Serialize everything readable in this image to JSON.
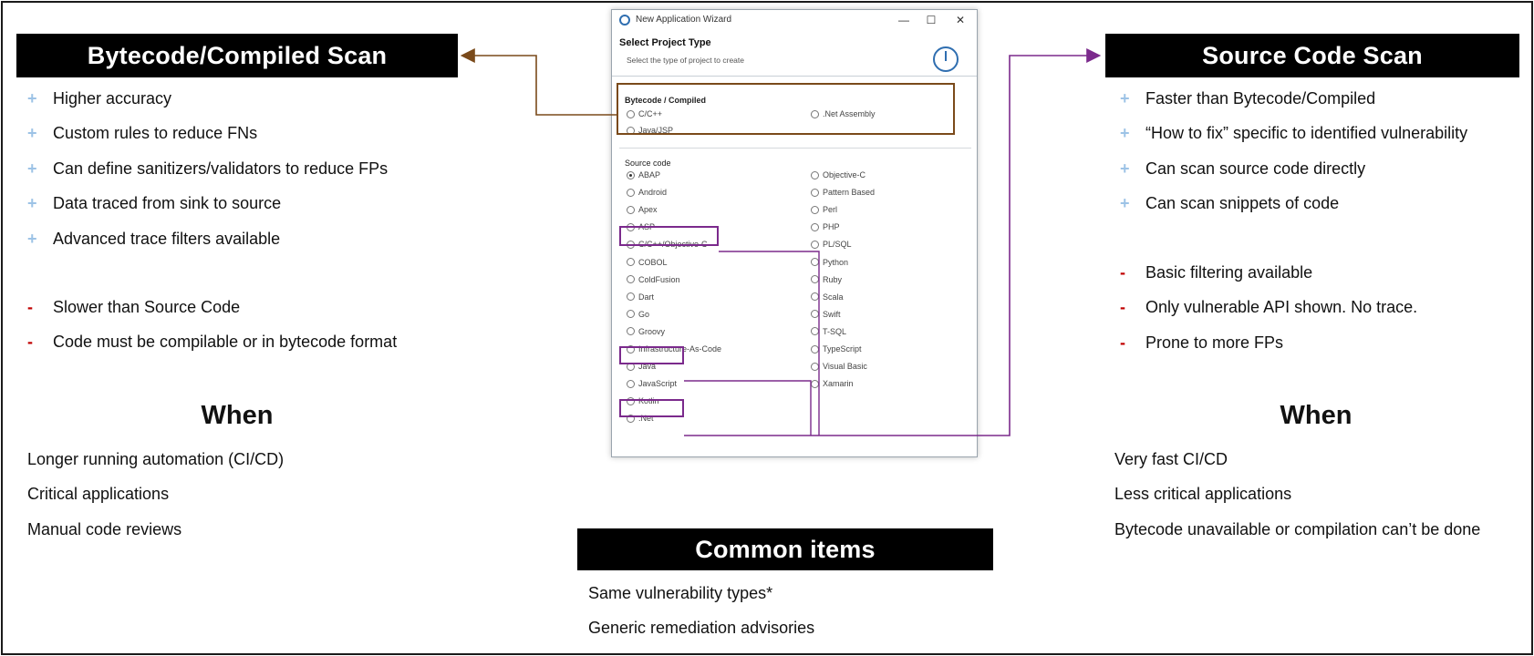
{
  "left": {
    "title": "Bytecode/Compiled Scan",
    "pros": [
      "Higher accuracy",
      "Custom rules to reduce FNs",
      "Can define sanitizers/validators to reduce FPs",
      "Data traced from sink to source",
      "Advanced trace filters available"
    ],
    "cons": [
      "Slower than Source Code",
      "Code must be compilable or in bytecode format"
    ],
    "when_title": "When",
    "when": [
      "Longer running automation (CI/CD)",
      "Critical applications",
      "Manual code reviews"
    ]
  },
  "right": {
    "title": "Source Code Scan",
    "pros": [
      "Faster than Bytecode/Compiled",
      "“How to fix” specific to identified vulnerability",
      "Can scan source code directly",
      "Can scan snippets of code"
    ],
    "cons": [
      "Basic filtering available",
      "Only vulnerable API shown. No trace.",
      "Prone to more FPs"
    ],
    "when_title": "When",
    "when": [
      "Very fast CI/CD",
      "Less critical applications",
      "Bytecode unavailable or compilation can’t be done"
    ]
  },
  "common": {
    "title": "Common items",
    "items": [
      "Same vulnerability types*",
      "Generic remediation advisories"
    ]
  },
  "markers": {
    "plus": "+",
    "minus": "-"
  },
  "dialog": {
    "window_title": "New Application Wizard",
    "minimize": "—",
    "maximize": "☐",
    "close": "✕",
    "header_title": "Select Project Type",
    "header_subtitle": "Select the type of project to create",
    "bytecode_group": "Bytecode / Compiled",
    "bytecode_options": [
      "C/C++",
      ".Net Assembly",
      "Java/JSP"
    ],
    "source_group": "Source code",
    "source_left": [
      "ABAP",
      "Android",
      "Apex",
      "ASP",
      "C/C++/Objective-C",
      "COBOL",
      "ColdFusion",
      "Dart",
      "Go",
      "Groovy",
      "Infrastructure-As-Code",
      "Java",
      "JavaScript",
      "Kotlin",
      ".Net"
    ],
    "source_right": [
      "Objective-C",
      "Pattern Based",
      "Perl",
      "PHP",
      "PL/SQL",
      "Python",
      "Ruby",
      "Scala",
      "Swift",
      "T-SQL",
      "TypeScript",
      "Visual Basic",
      "Xamarin"
    ]
  },
  "colors": {
    "banner_bg": "#000000",
    "plus": "#9dc3e6",
    "minus": "#c00000",
    "bytecode_connector": "#7a4a1a",
    "source_connector": "#7b2a8c"
  }
}
